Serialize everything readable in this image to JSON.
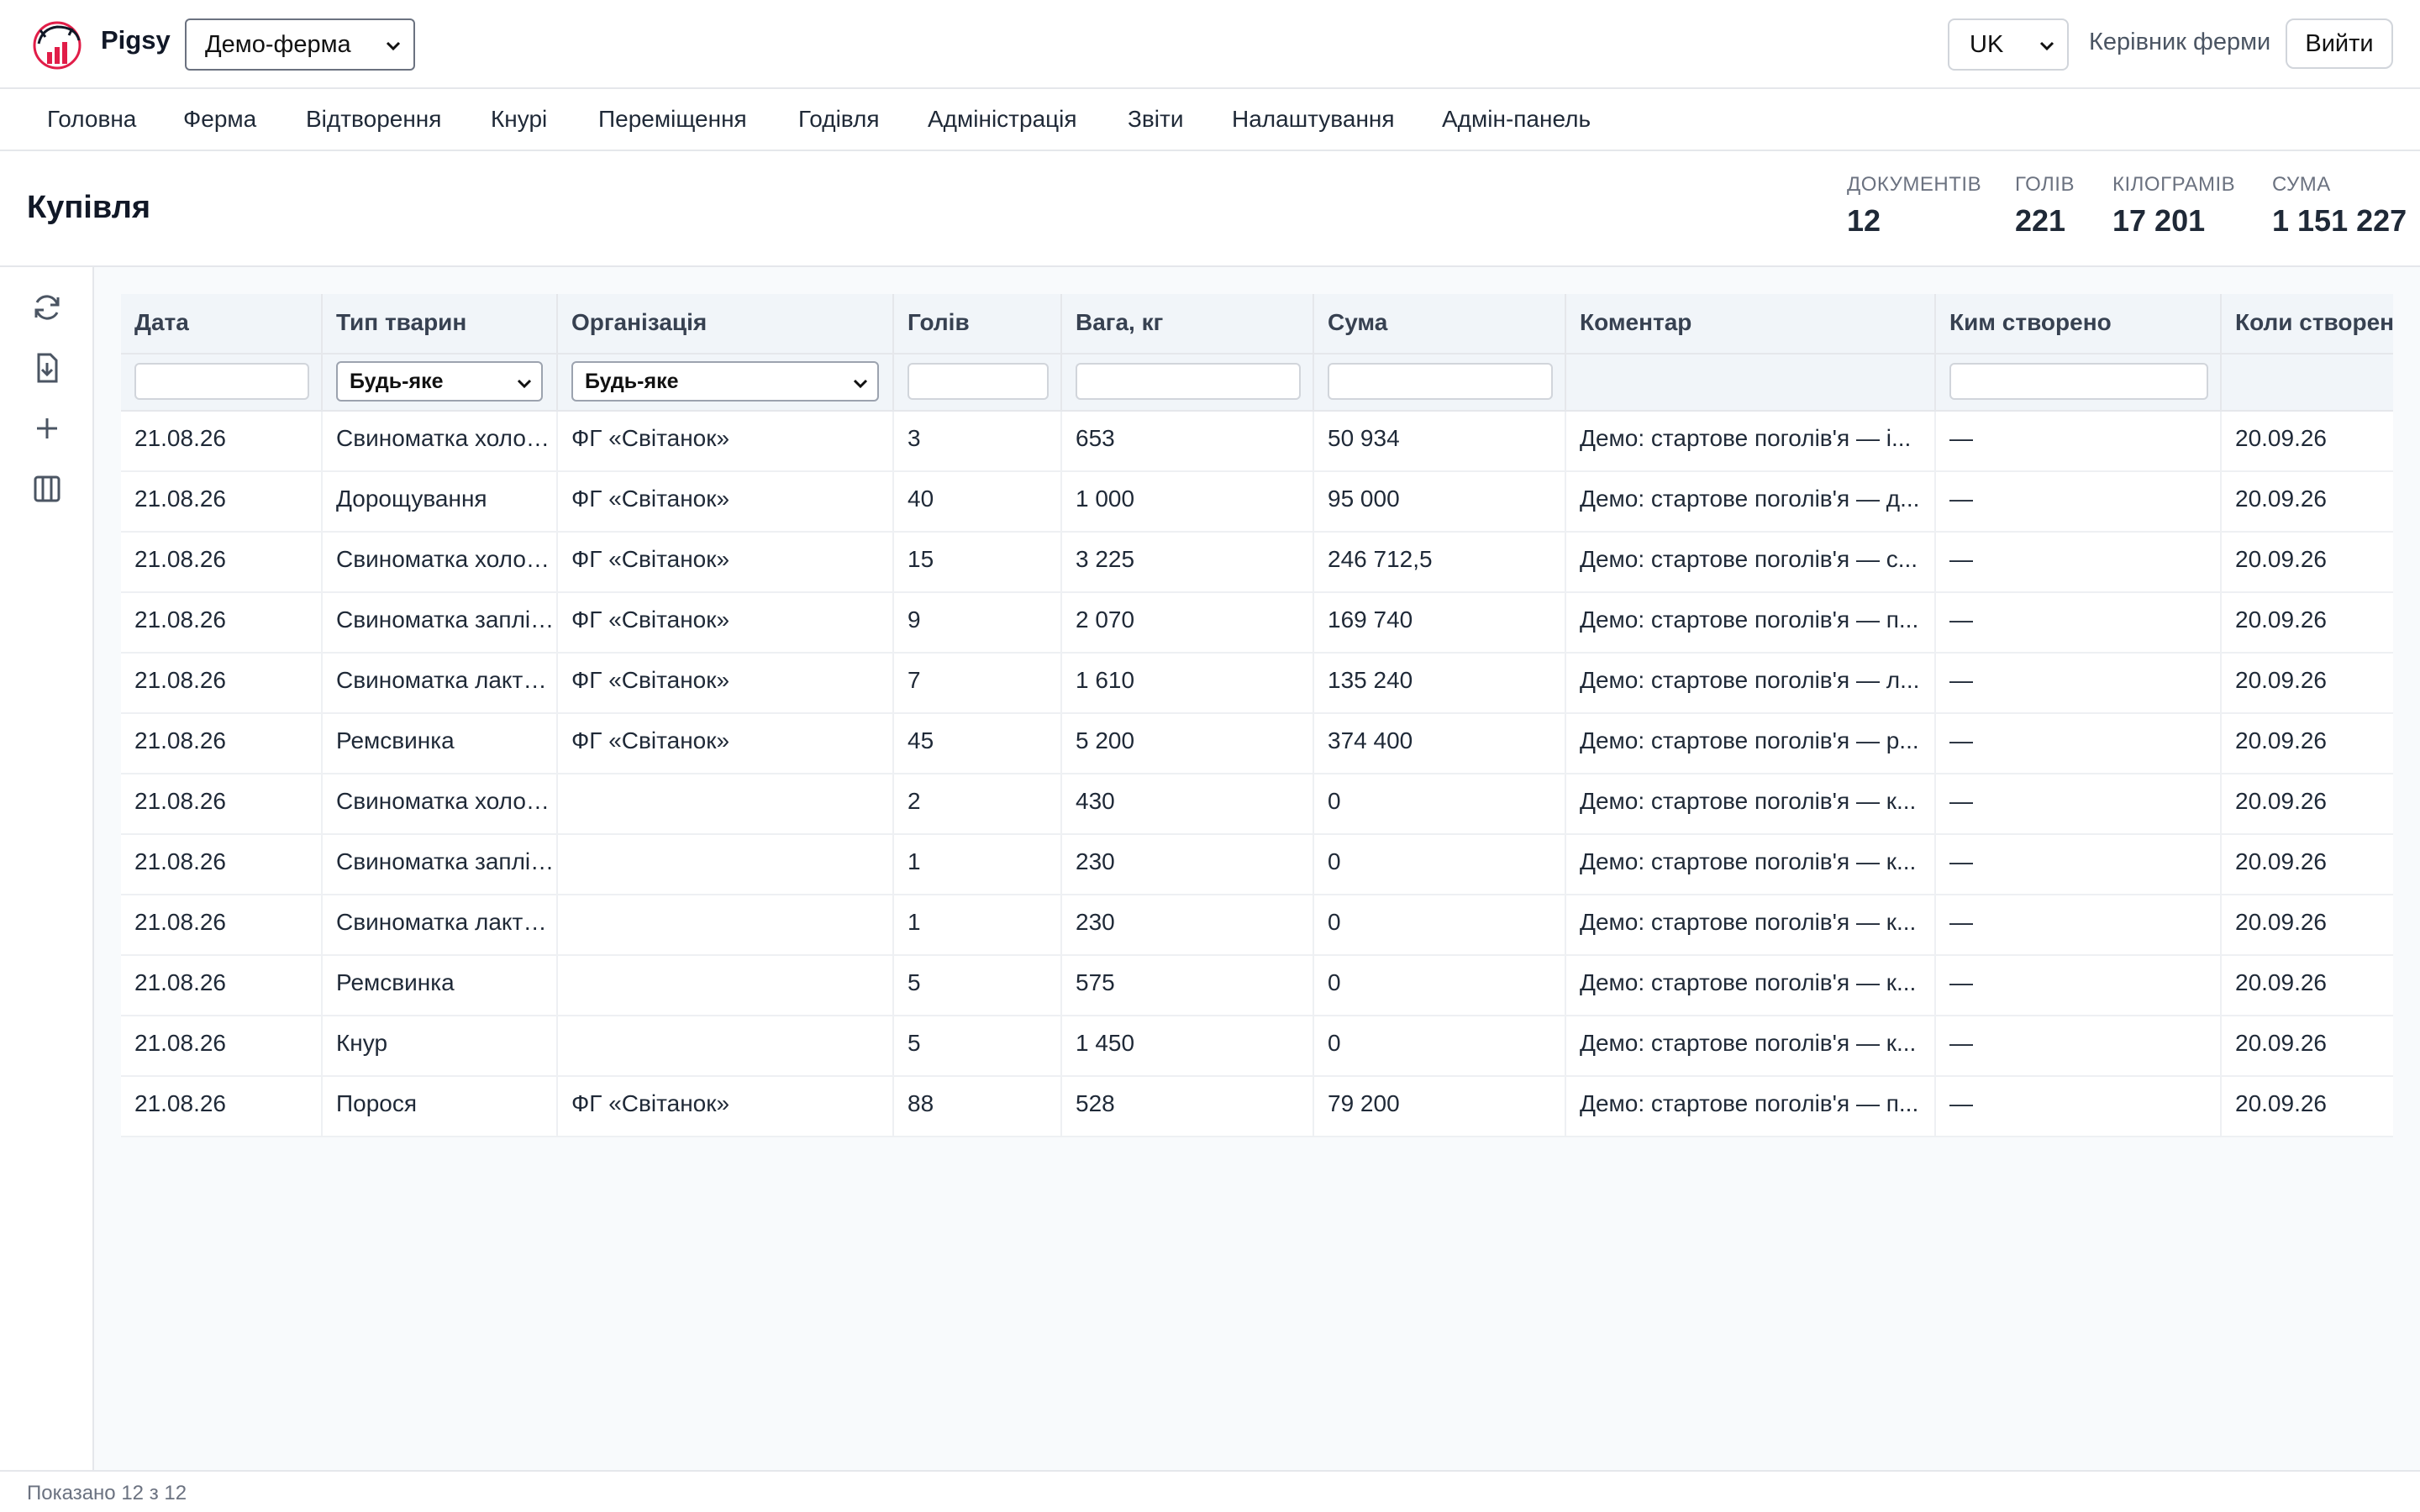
{
  "app": {
    "name": "Pigsy"
  },
  "header": {
    "farm_selected": "Демо-ферма",
    "lang_selected": "UK",
    "role": "Керівник ферми",
    "logout": "Вийти"
  },
  "nav": [
    "Головна",
    "Ферма",
    "Відтворення",
    "Кнурі",
    "Переміщення",
    "Годівля",
    "Адміністрація",
    "Звіти",
    "Налаштування",
    "Адмін-панель"
  ],
  "page": {
    "title": "Купівля"
  },
  "stats": [
    {
      "label": "ДОКУМЕНТІВ",
      "value": "12"
    },
    {
      "label": "ГОЛІВ",
      "value": "221"
    },
    {
      "label": "КІЛОГРАМІВ",
      "value": "17 201"
    },
    {
      "label": "СУМА",
      "value": "1 151 227"
    }
  ],
  "tools": [
    "refresh-icon",
    "download-icon",
    "plus-icon",
    "columns-icon"
  ],
  "table": {
    "columns": [
      "Дата",
      "Тип тварин",
      "Організація",
      "Голів",
      "Вага, кг",
      "Сума",
      "Коментар",
      "Ким створено",
      "Коли створено"
    ],
    "filter_any": "Будь-яке",
    "rows": [
      [
        "21.08.26",
        "Свиноматка холостa",
        "ФГ «Світанок»",
        "3",
        "653",
        "50 934",
        "Демо: стартове поголів'я — і...",
        "—",
        "20.09.26"
      ],
      [
        "21.08.26",
        "Дорощування",
        "ФГ «Світанок»",
        "40",
        "1 000",
        "95 000",
        "Демо: стартове поголів'я — д...",
        "—",
        "20.09.26"
      ],
      [
        "21.08.26",
        "Свиноматка холостa",
        "ФГ «Світанок»",
        "15",
        "3 225",
        "246 712,5",
        "Демо: стартове поголів'я — с...",
        "—",
        "20.09.26"
      ],
      [
        "21.08.26",
        "Свиноматка запліднена",
        "ФГ «Світанок»",
        "9",
        "2 070",
        "169 740",
        "Демо: стартове поголів'я — п...",
        "—",
        "20.09.26"
      ],
      [
        "21.08.26",
        "Свиноматка лактуюча",
        "ФГ «Світанок»",
        "7",
        "1 610",
        "135 240",
        "Демо: стартове поголів'я — л...",
        "—",
        "20.09.26"
      ],
      [
        "21.08.26",
        "Ремсвинка",
        "ФГ «Світанок»",
        "45",
        "5 200",
        "374 400",
        "Демо: стартове поголів'я — р...",
        "—",
        "20.09.26"
      ],
      [
        "21.08.26",
        "Свиноматка холостa",
        "",
        "2",
        "430",
        "0",
        "Демо: стартове поголів'я — к...",
        "—",
        "20.09.26"
      ],
      [
        "21.08.26",
        "Свиноматка запліднена",
        "",
        "1",
        "230",
        "0",
        "Демо: стартове поголів'я — к...",
        "—",
        "20.09.26"
      ],
      [
        "21.08.26",
        "Свиноматка лактуюча",
        "",
        "1",
        "230",
        "0",
        "Демо: стартове поголів'я — к...",
        "—",
        "20.09.26"
      ],
      [
        "21.08.26",
        "Ремсвинка",
        "",
        "5",
        "575",
        "0",
        "Демо: стартове поголів'я — к...",
        "—",
        "20.09.26"
      ],
      [
        "21.08.26",
        "Кнур",
        "",
        "5",
        "1 450",
        "0",
        "Демо: стартове поголів'я — к...",
        "—",
        "20.09.26"
      ],
      [
        "21.08.26",
        "Порося",
        "ФГ «Світанок»",
        "88",
        "528",
        "79 200",
        "Демо: стартове поголів'я — п...",
        "—",
        "20.09.26"
      ]
    ]
  },
  "footer": {
    "text": "Показано 12 з 12"
  },
  "colors": {
    "accent": "#e11d48",
    "border": "#e5e7eb",
    "header_bg": "#f1f5f9",
    "content_bg": "#f8fafc"
  }
}
